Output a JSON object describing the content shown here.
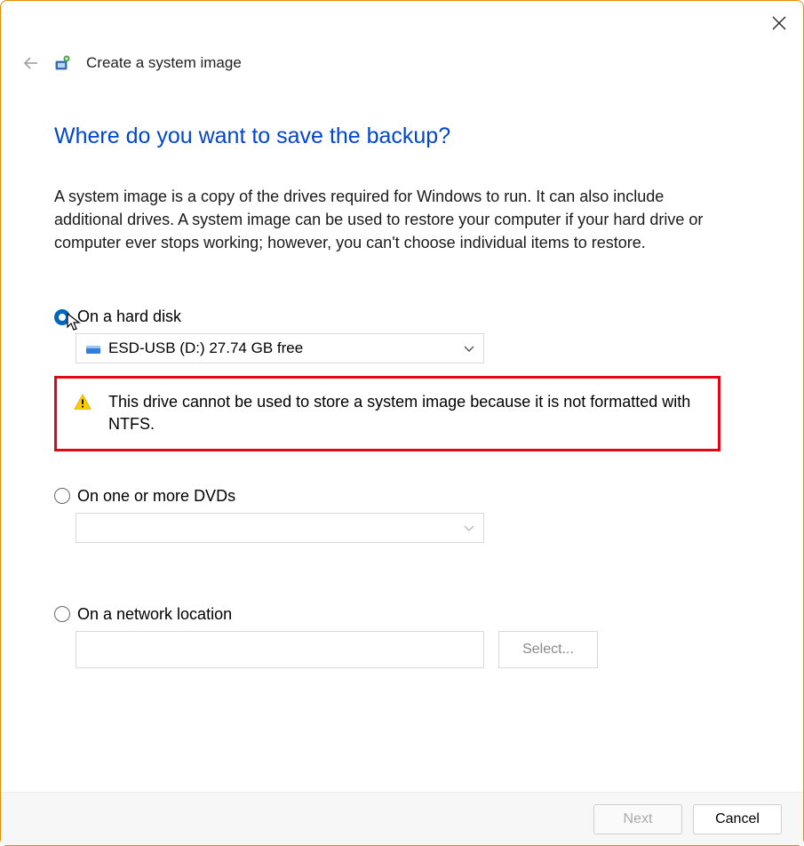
{
  "window": {
    "title": "Create a system image"
  },
  "heading": "Where do you want to save the backup?",
  "description": "A system image is a copy of the drives required for Windows to run. It can also include additional drives. A system image can be used to restore your computer if your hard drive or computer ever stops working; however, you can't choose individual items to restore.",
  "options": {
    "hard_disk": {
      "label": "On a hard disk",
      "selected": true,
      "drive_label": "ESD-USB (D:)  27.74 GB free",
      "warning": "This drive cannot be used to store a system image because it is not formatted with NTFS."
    },
    "dvd": {
      "label": "On one or more DVDs",
      "selected": false
    },
    "network": {
      "label": "On a network location",
      "selected": false,
      "path": "",
      "select_button": "Select..."
    }
  },
  "footer": {
    "next": "Next",
    "cancel": "Cancel",
    "next_enabled": false
  }
}
